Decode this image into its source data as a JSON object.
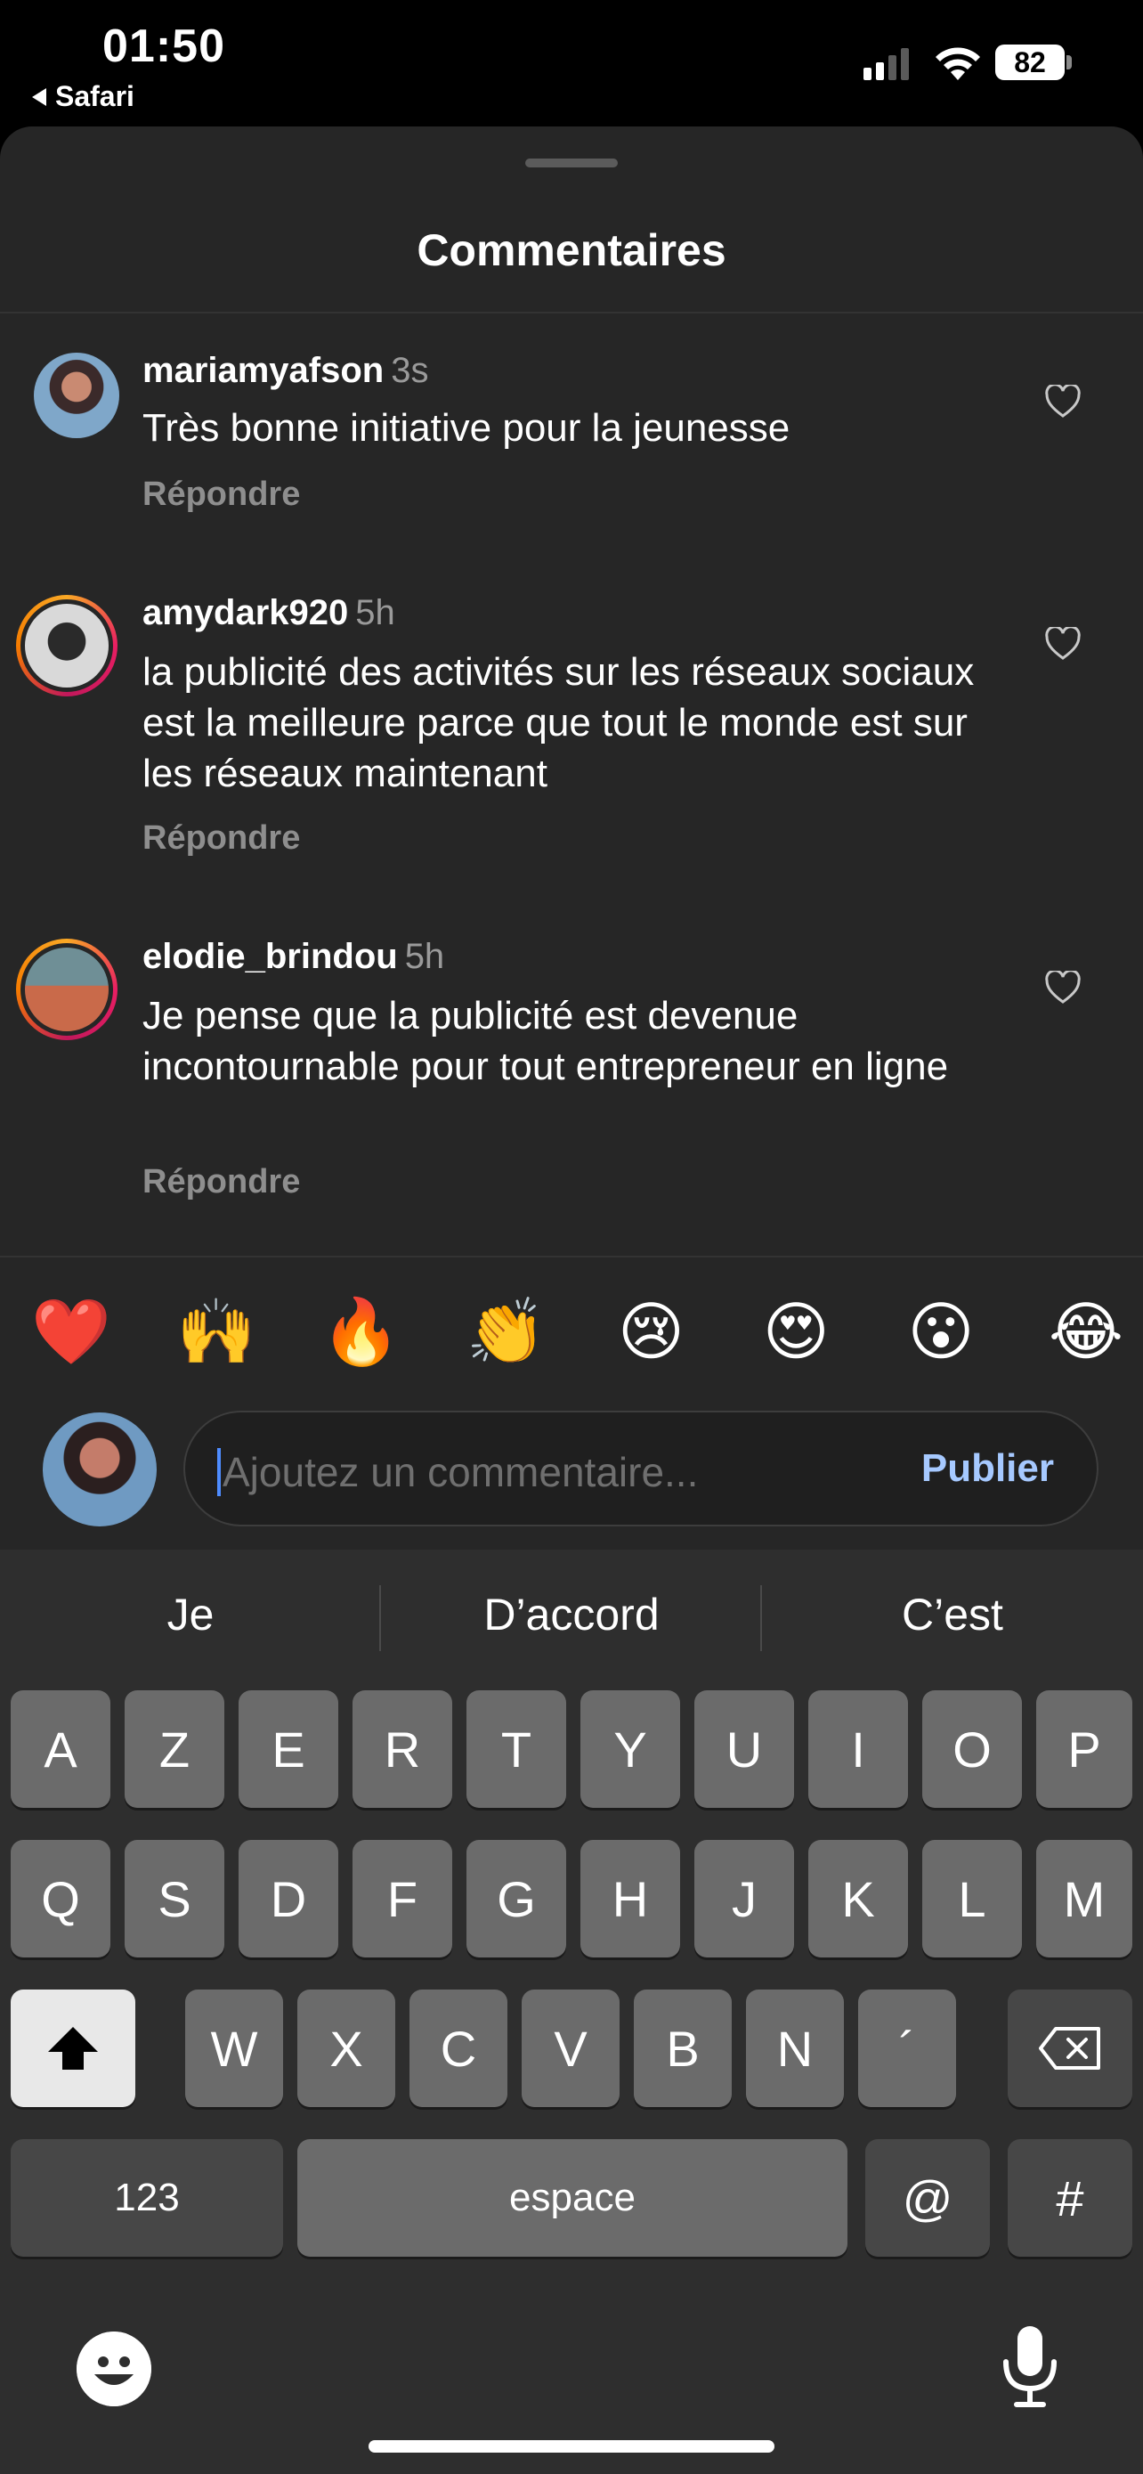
{
  "status_bar": {
    "time": "01:50",
    "back_app": "Safari",
    "battery": "82"
  },
  "sheet": {
    "title": "Commentaires"
  },
  "comments": [
    {
      "user": "mariamyafson",
      "time": "3s",
      "text": "Très bonne initiative pour la jeunesse",
      "reply": "Répondre"
    },
    {
      "user": "amydark920",
      "time": "5h",
      "text": "la publicité des activités sur les réseaux sociaux est la meilleure parce que tout le monde est sur les réseaux maintenant",
      "reply": "Répondre"
    },
    {
      "user": "elodie_brindou",
      "time": "5h",
      "text": "Je pense que la publicité est devenue incontournable pour tout entrepreneur en ligne",
      "reply": "Répondre"
    }
  ],
  "reactions": [
    "❤️",
    "🙌",
    "🔥",
    "👏",
    "😢",
    "😍",
    "😮",
    "😂"
  ],
  "composer": {
    "placeholder": "Ajoutez un commentaire...",
    "publish_label": "Publier"
  },
  "keyboard": {
    "predictions": [
      "Je",
      "D’accord",
      "C’est"
    ],
    "row1": [
      "A",
      "Z",
      "E",
      "R",
      "T",
      "Y",
      "U",
      "I",
      "O",
      "P"
    ],
    "row2": [
      "Q",
      "S",
      "D",
      "F",
      "G",
      "H",
      "J",
      "K",
      "L",
      "M"
    ],
    "row3": [
      "W",
      "X",
      "C",
      "V",
      "B",
      "N",
      "´"
    ],
    "numbers_label": "123",
    "space_label": "espace",
    "at_label": "@",
    "hash_label": "#"
  },
  "colors": {
    "accent": "#a6c9ff",
    "sheet_bg": "#262626",
    "key_bg": "#6b6b6b"
  }
}
